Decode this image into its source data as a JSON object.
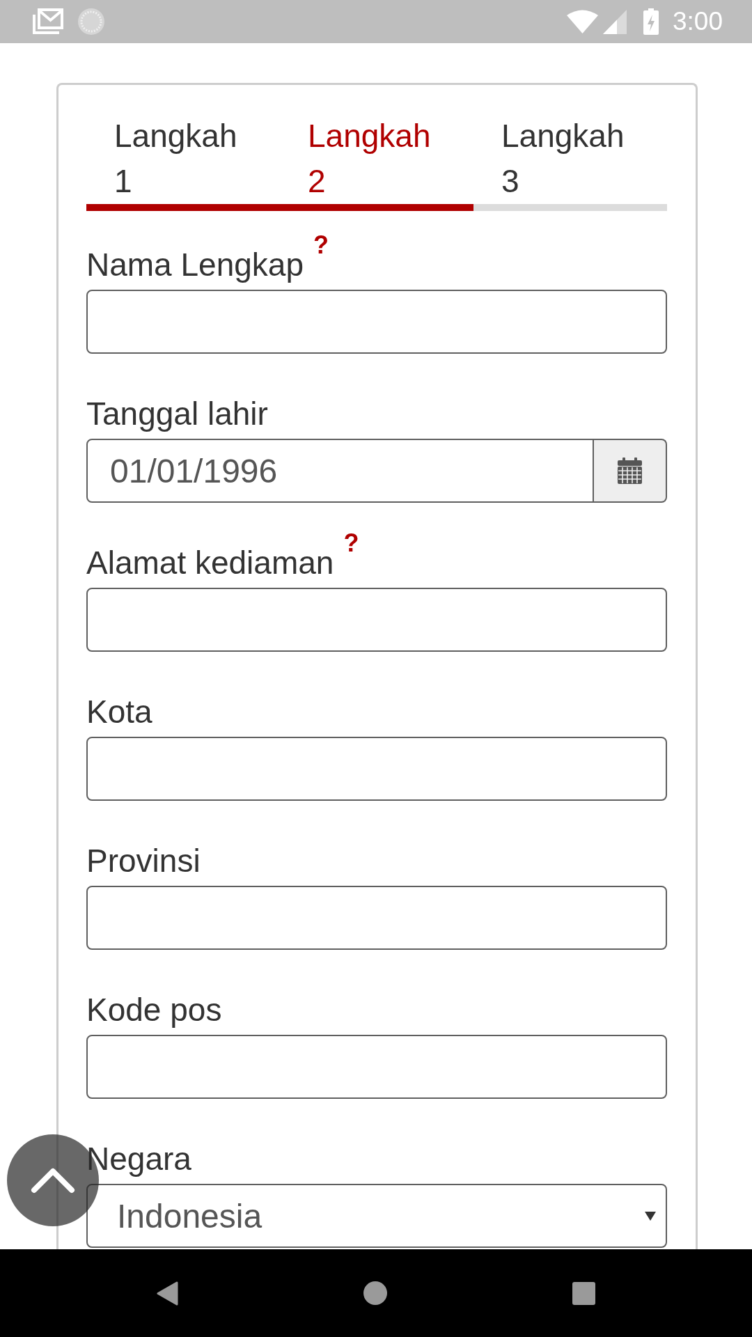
{
  "status_bar": {
    "time": "3:00"
  },
  "tabs": [
    {
      "label": "Langkah 1",
      "selected": false,
      "reached": true
    },
    {
      "label": "Langkah 2",
      "selected": true,
      "reached": true
    },
    {
      "label": "Langkah 3",
      "selected": false,
      "reached": false
    }
  ],
  "fields": [
    {
      "kind": "text",
      "label": "Nama Lengkap",
      "help": "?"
    },
    {
      "kind": "date",
      "label": "Tanggal lahir",
      "value": "01/01/1996"
    },
    {
      "kind": "text",
      "label": "Alamat kediaman",
      "help": "?"
    },
    {
      "kind": "text",
      "label": "Kota"
    },
    {
      "kind": "text",
      "label": "Provinsi"
    },
    {
      "kind": "text",
      "label": "Kode pos"
    },
    {
      "kind": "select",
      "label": "Negara",
      "value": "Indonesia"
    }
  ]
}
